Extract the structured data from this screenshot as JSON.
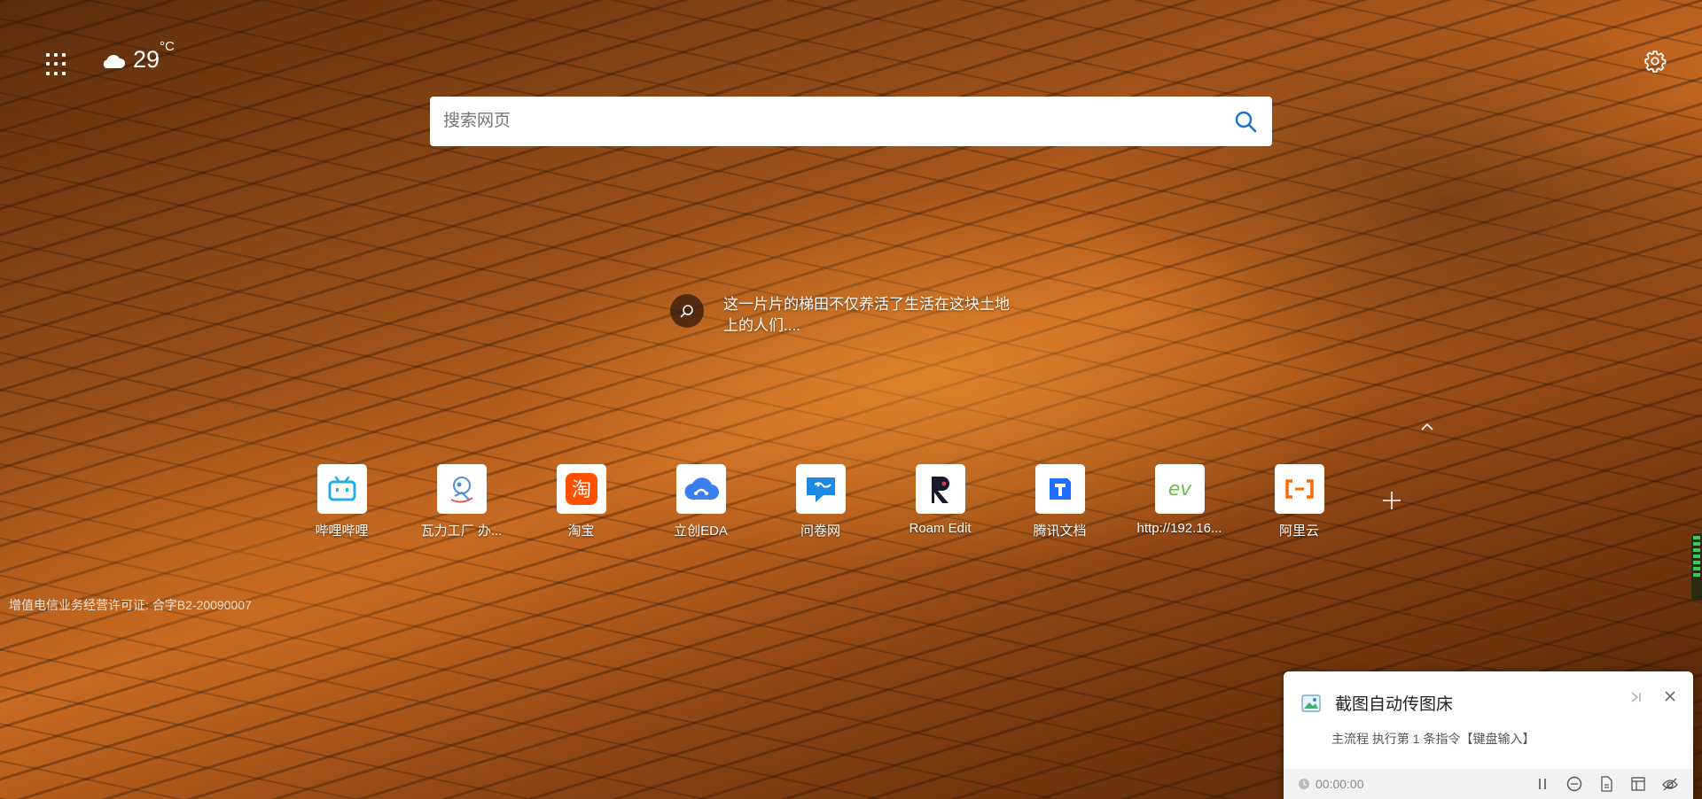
{
  "weather": {
    "temperature": "29",
    "unit": "°C",
    "icon": "cloud-icon"
  },
  "search": {
    "placeholder": "搜索网页",
    "icon": "search-icon"
  },
  "caption": {
    "text": "这一片片的梯田不仅养活了生活在这块土地上的人们....",
    "icon": "search-icon"
  },
  "tiles": [
    {
      "label": "哔哩哔哩",
      "icon": "bilibili-icon",
      "color": "#23ade5"
    },
    {
      "label": "瓦力工厂 办...",
      "icon": "wali-icon",
      "color": "#4a8fd8"
    },
    {
      "label": "淘宝",
      "icon": "taobao-icon",
      "color": "#ff5000"
    },
    {
      "label": "立创EDA",
      "icon": "lceda-icon",
      "color": "#3a7ff0"
    },
    {
      "label": "问卷网",
      "icon": "wenjuan-icon",
      "color": "#1e88e5"
    },
    {
      "label": "Roam Edit",
      "icon": "roam-icon",
      "color": "#1a1a2e"
    },
    {
      "label": "腾讯文档",
      "icon": "tencent-docs-icon",
      "color": "#1e6fff"
    },
    {
      "label": "http://192.16...",
      "icon": "ev-icon",
      "color": "#6cc04a"
    },
    {
      "label": "阿里云",
      "icon": "aliyun-icon",
      "color": "#ff6a00"
    }
  ],
  "license": "增值电信业务经营许可证: 合字B2-20090007",
  "notification": {
    "title": "截图自动传图床",
    "subtitle": "主流程 执行第 1 条指令【键盘输入】",
    "timer": "00:00:00"
  }
}
